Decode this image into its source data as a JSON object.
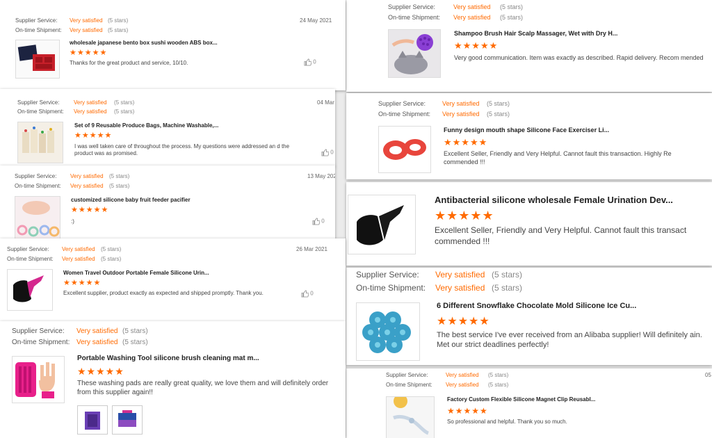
{
  "labels": {
    "supplier_service": "Supplier Service:",
    "ontime_shipment": "On-time Shipment:",
    "very_satisfied": "Very satisfied",
    "five_stars": "(5 stars)",
    "stars": "★★★★★"
  },
  "colors": {
    "accent": "#ff6a00",
    "background": "#ebebeb"
  },
  "reviews": [
    {
      "date": "24 May 2021",
      "title": "wholesale japanese bento box sushi wooden ABS box...",
      "comment": "Thanks for the great product and service, 10/10.",
      "likes": "0",
      "icon": "bento-box-image"
    },
    {
      "date": "04 Mar",
      "title": "Set of 9 Reusable Produce Bags, Machine Washable,...",
      "comment": "I was well taken care of throughout the process. My questions were addressed an d the product was as promised.",
      "likes": "0",
      "icon": "produce-bags-image"
    },
    {
      "date": "13 May 202",
      "title": "customized silicone baby fruit feeder pacifier",
      "comment": ":)",
      "likes": "0",
      "icon": "baby-feeder-image"
    },
    {
      "date": "26 Mar 2021",
      "title": "Women Travel Outdoor Portable Female Silicone Urin...",
      "comment": "Excellent supplier, product exactly as expected and shipped promptly.  Thank you.",
      "likes": "0",
      "icon": "urination-device-image"
    },
    {
      "date": "",
      "title": "Portable Washing Tool silicone brush cleaning mat m...",
      "comment": "These washing pads are really great quality, we love them and will definitely order from this supplier again!!",
      "likes": "",
      "icon": "washing-pad-image"
    },
    {
      "date": "",
      "title": "Shampoo Brush Hair Scalp Massager, Wet with Dry H...",
      "comment": "Very good communication. Item was exactly as described. Rapid delivery. Recom mended",
      "likes": "",
      "icon": "shampoo-brush-image"
    },
    {
      "date": "",
      "title": "Funny design mouth shape Silicone Face Exerciser Li...",
      "comment": "Excellent Seller, Friendly and Very Helpful. Cannot fault this transaction. Highly Re commended !!!",
      "likes": "",
      "icon": "face-exerciser-image"
    },
    {
      "date": "",
      "title": "Antibacterial silicone wholesale Female Urination Dev...",
      "comment": "Excellent Seller, Friendly and Very Helpful. Cannot fault this transact commended !!!",
      "likes": "",
      "icon": "urination-device-image"
    },
    {
      "date": "",
      "title": "6 Different Snowflake Chocolate Mold Silicone Ice Cu...",
      "comment": "The best service I've ever received from an Alibaba supplier! Will definitely ain. Met our strict deadlines perfectly!",
      "likes": "",
      "icon": "snowflake-mold-image"
    },
    {
      "date": "05",
      "title": "Factory Custom Flexible Silicone Magnet Clip Reusabl...",
      "comment": "So professional and helpful. Thank you so much.",
      "likes": "",
      "icon": "magnet-clip-image"
    }
  ]
}
